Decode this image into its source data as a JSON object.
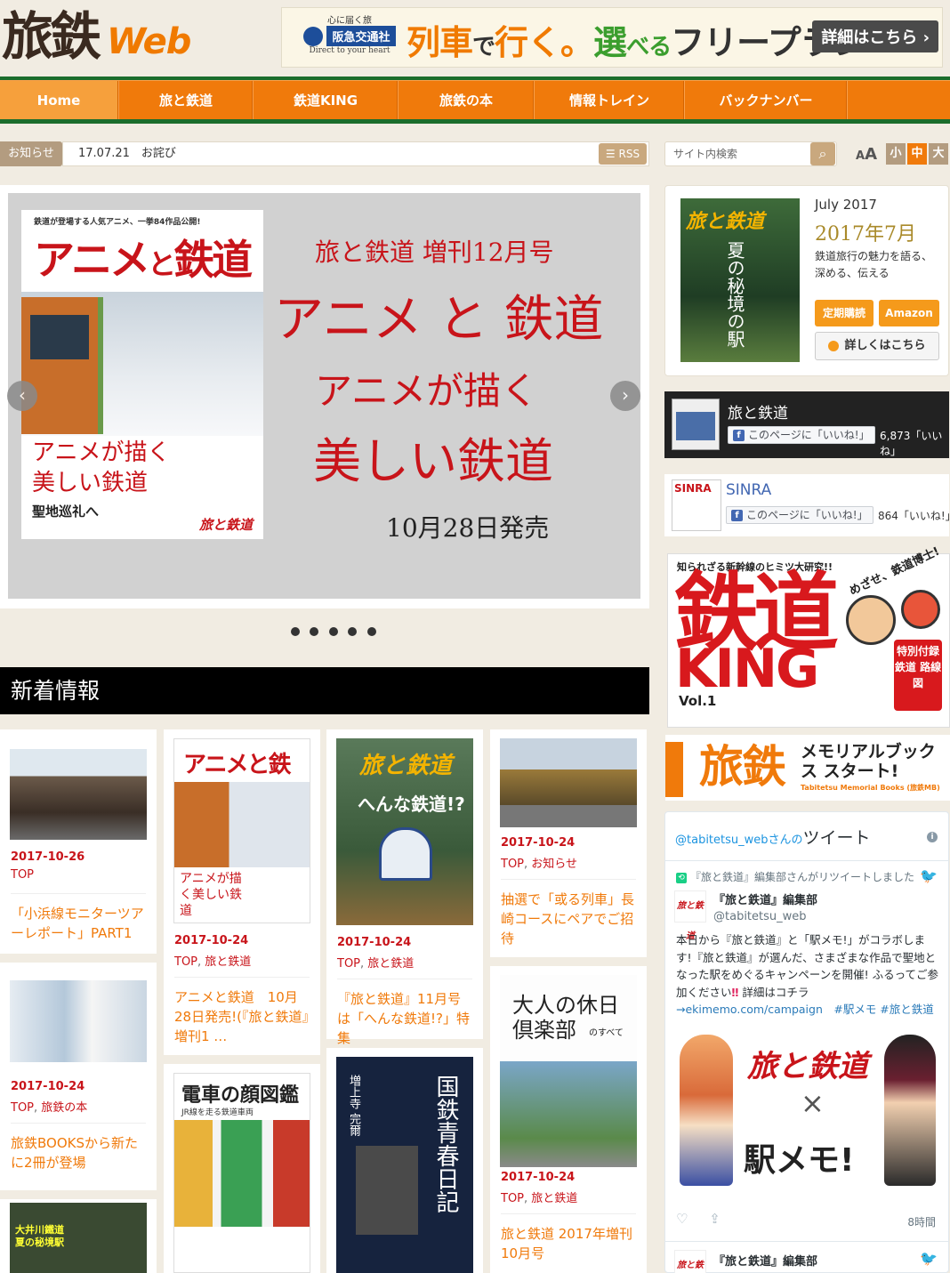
{
  "header": {
    "logo_kanji": "旅鉄",
    "logo_web": "Web",
    "banner": {
      "tagline": "心に届く旅",
      "company": "阪急交通社",
      "subline": "Direct to your heart",
      "copy_1": "列車",
      "copy_2": "で",
      "copy_3": "行く。",
      "copy_4": "選",
      "copy_5": "べる",
      "copy_6": "フリープラン",
      "detail_label": "詳細はこちら ›"
    }
  },
  "nav": {
    "items": [
      {
        "label": "Home"
      },
      {
        "label": "旅と鉄道"
      },
      {
        "label": "鉄道KING"
      },
      {
        "label": "旅鉄の本"
      },
      {
        "label": "情報トレイン"
      },
      {
        "label": "バックナンバー"
      }
    ]
  },
  "news": {
    "tag": "お知らせ",
    "text": "17.07.21　お詫び",
    "rss": "RSS"
  },
  "search": {
    "placeholder": "サイト内検索",
    "font_size_label_small": "A",
    "font_size_label_large": "A",
    "sizes": [
      "小",
      "中",
      "大"
    ]
  },
  "slider": {
    "cover": {
      "tag": "鉄道が登場する人気アニメ、一挙84作品公開!",
      "title_1": "アニメ",
      "title_2": "と",
      "title_3": "鉄道",
      "caption_1": "アニメが描く",
      "caption_2": "美しい鉄道",
      "subcaption": "聖地巡礼へ",
      "brand": "旅と鉄道"
    },
    "line1": "旅と鉄道 増刊12月号",
    "line2": "アニメ と 鉄道",
    "line3": "アニメが描く",
    "line4": "美しい鉄道",
    "line5": "10月28日発売",
    "prev": "‹",
    "next": "›",
    "dots": 5
  },
  "sidebar": {
    "magazine": {
      "cover_title": "旅と鉄道",
      "cover_vertical": "夏の秘境の駅",
      "month_en": "July 2017",
      "month_jp": "2017年7月",
      "desc": "鉄道旅行の魅力を語る、深める、伝える",
      "btn_subscribe": "定期購読",
      "btn_amazon": "Amazon",
      "btn_detail": "詳しくはこちら"
    },
    "fb1": {
      "name": "旅と鉄道",
      "like": "このページに「いいね!」",
      "count": "6,873「いいね」"
    },
    "fb2": {
      "name": "SINRA",
      "pic_label": "SINRA",
      "like": "このページに「いいね!」",
      "count": "864「いいね!」"
    },
    "king": {
      "kicker": "知られざる新幹線のヒミツ大研究!!",
      "title_1": "鉄道",
      "title_2": "KING",
      "vol": "Vol.1",
      "aim": "めざせ、鉄道博士!",
      "extra": "特別付録 鉄道 路線図"
    },
    "memorial": {
      "brand": "旅鉄",
      "title": "メモリアルブックス スタート!",
      "sub": "Tabitetsu Memorial Books (旅鉄MB)"
    },
    "twitter": {
      "header_handle": "@tabitetsu_webさんの",
      "header_label": "ツイート",
      "retweet": "『旅と鉄道』編集部さんがリツイートしました",
      "user_name": "『旅と鉄道』編集部",
      "screen_name": "@tabitetsu_web",
      "avatar": "旅と鉄道",
      "body_1": "本日から『旅と鉄道』と「駅メモ!」がコラボします!『旅と鉄道』が選んだ、さまざまな作品で聖地となった駅をめぐるキャンペーンを開催! ふるってご参加ください",
      "body_mark": "‼",
      "body_2": " 詳細はコチラ",
      "body_link": "→ekimemo.com/campaign　#駅メモ #旅と鉄道",
      "img_logo": "旅と鉄道",
      "img_x": "×",
      "img_ekimemo": "駅メモ!",
      "time": "8時間",
      "next_user": "『旅と鉄道』編集部"
    }
  },
  "new_info": {
    "heading": "新着情報",
    "cards": [
      {
        "date": "2017-10-26",
        "cat": "TOP",
        "title": "「小浜線モニターツアーレポート」PART1"
      },
      {
        "date": "2017-10-24",
        "cat_1": "TOP",
        "cat_2": "旅と鉄道",
        "title": "アニメと鉄道　10月28日発売!(『旅と鉄道』増刊1 …",
        "cover_title": "アニメと鉄道",
        "cover_caption": "アニメが描く美しい鉄道"
      },
      {
        "date": "2017-10-24",
        "cat_1": "TOP",
        "cat_2": "旅と鉄道",
        "title": "『旅と鉄道』11月号は「へんな鉄道!?」特集",
        "cover_title": "旅と鉄道",
        "cover_caption": "へんな鉄道!?"
      },
      {
        "date": "2017-10-24",
        "cat_1": "TOP",
        "cat_2": "お知らせ",
        "title": "抽選で「或る列車」長崎コースにペアでご招待"
      },
      {
        "date": "2017-10-24",
        "cat_1": "TOP",
        "cat_2": "旅鉄の本",
        "title": "旅鉄BOOKSから新たに2冊が登場"
      },
      {
        "date": "2017-10-24",
        "cat_1": "TOP",
        "cat_2": "旅と鉄道",
        "title": "旅と鉄道 2017年増刊10月号",
        "cover_title": "大人の休日倶楽部",
        "cover_caption": "のすべて"
      },
      {
        "cover_title": "電車の顔図鑑",
        "cover_caption": "JR線を走る鉄道車両"
      },
      {
        "cover_title": "国鉄青春日記",
        "cover_caption": "増上寺 完爾"
      },
      {
        "cover_title": "大井川鐵道",
        "cover_caption": "夏の秘境駅"
      }
    ]
  },
  "colors": {
    "orange": "#f07a0b",
    "green": "#1b6d2c",
    "red": "#c8141a",
    "brown": "#b39c80"
  }
}
